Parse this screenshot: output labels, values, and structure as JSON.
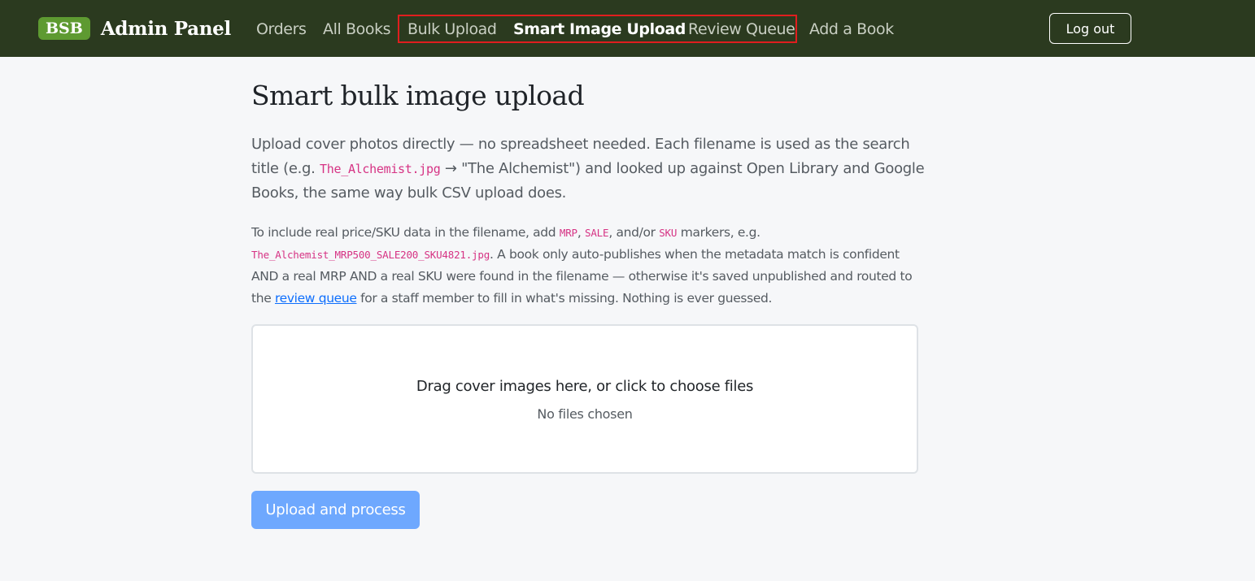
{
  "navbar": {
    "brand_badge": "BSB",
    "brand_title": "Admin Panel",
    "links": [
      {
        "label": "Orders"
      },
      {
        "label": "All Books"
      },
      {
        "label": "Bulk Upload"
      },
      {
        "label": "Smart Image Upload",
        "active": true
      },
      {
        "label": "Review Queue"
      },
      {
        "label": "Add a Book"
      }
    ],
    "logout_label": "Log out"
  },
  "main": {
    "title": "Smart bulk image upload",
    "lead": {
      "part1": "Upload cover photos directly — no spreadsheet needed. Each filename is used as the search title (e.g. ",
      "example_file": "The_Alchemist.jpg",
      "part2": " → \"The Alchemist\") and looked up against Open Library and Google Books, the same way bulk CSV upload does."
    },
    "details": {
      "part1": "To include real price/SKU data in the filename, add ",
      "marker_mrp": "MRP",
      "sep1": ", ",
      "marker_sale": "SALE",
      "sep2": ", and/or ",
      "marker_sku": "SKU",
      "part2": " markers, e.g. ",
      "example_file": "The_Alchemist_MRP500_SALE200_SKU4821.jpg",
      "part3": ". A book only auto-publishes when the metadata match is confident AND a real MRP AND a real SKU were found in the filename — otherwise it's saved unpublished and routed to the ",
      "review_link": "review queue",
      "part4": " for a staff member to fill in what's missing. Nothing is ever guessed."
    },
    "dropzone": {
      "title": "Drag cover images here, or click to choose files",
      "status": "No files chosen"
    },
    "upload_button": "Upload and process"
  },
  "colors": {
    "navbar_bg": "#2b3a1f",
    "brand_badge_bg": "#5e9a31",
    "highlight_border": "#e01e1e",
    "code_text": "#d63384",
    "link": "#0d6efd",
    "primary_button": "#6ea8fe"
  }
}
